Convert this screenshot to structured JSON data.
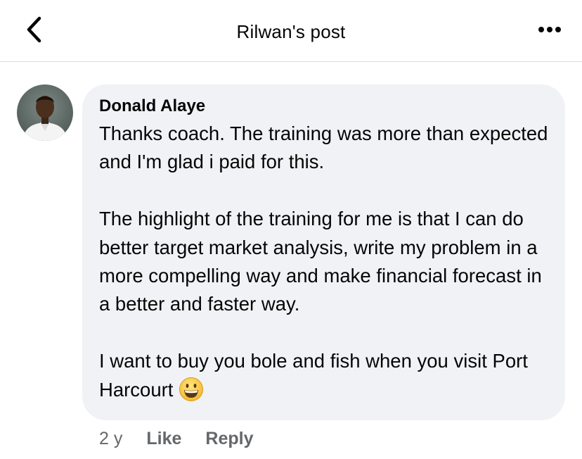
{
  "header": {
    "title": "Rilwan's post",
    "back_icon": "chevron-left-icon",
    "more_icon": "more-horizontal-icon"
  },
  "comment": {
    "author": "Donald Alaye",
    "paragraphs": [
      "Thanks coach. The training was more than expected and I'm glad i paid for this.",
      "The highlight of the training for me is that I can do better target market analysis, write my problem in a more compelling way and make financial forecast in a better and faster way.",
      "I want to buy you bole and fish when you visit Port Harcourt"
    ],
    "emoji_icon": "grinning-face-icon",
    "time": "2 y",
    "like_label": "Like",
    "reply_label": "Reply"
  },
  "colors": {
    "bubble": "#f0f2f5",
    "meta_text": "#65676b",
    "primary_text": "#050505"
  }
}
